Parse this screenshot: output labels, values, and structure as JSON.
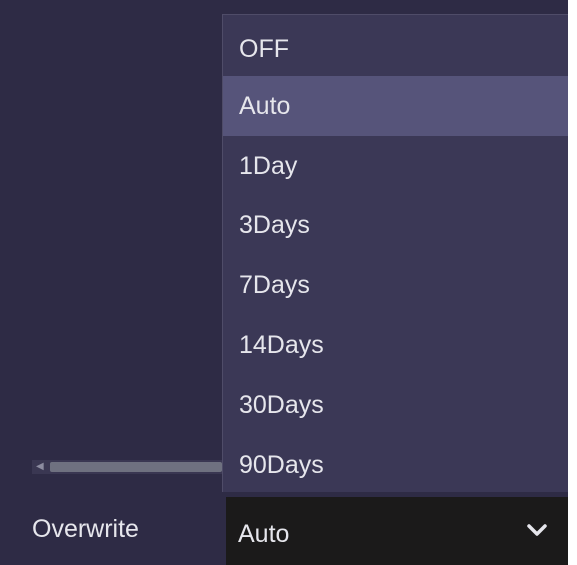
{
  "dropdown": {
    "options": [
      {
        "label": "OFF"
      },
      {
        "label": "Auto"
      },
      {
        "label": "1Day"
      },
      {
        "label": "3Days"
      },
      {
        "label": "7Days"
      },
      {
        "label": "14Days"
      },
      {
        "label": "30Days"
      },
      {
        "label": "90Days"
      }
    ],
    "selected_label": "Auto"
  },
  "field": {
    "label": "Overwrite",
    "value": "Auto",
    "icon": "chevron-down-icon"
  },
  "colors": {
    "background": "#2e2b45",
    "dropdown_bg": "#3b3856",
    "highlight": "#56547a",
    "select_bg": "#1b1a1a",
    "text": "#e6e6ec"
  }
}
